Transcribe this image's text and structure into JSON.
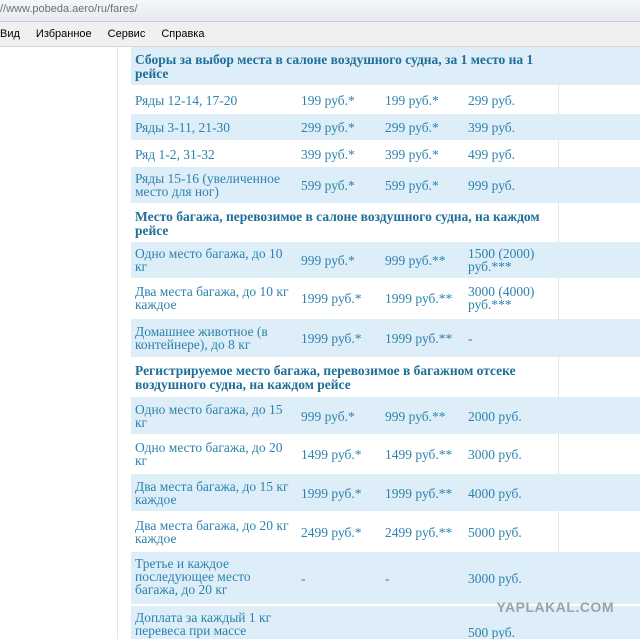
{
  "browser": {
    "url": "//www.pobeda.aero/ru/fares/"
  },
  "menu": [
    "Вид",
    "Избранное",
    "Сервис",
    "Справка"
  ],
  "sections": [
    {
      "title": "Сборы за выбор места в салоне воздушного судна, за 1 место на 1 рейсе",
      "rows": [
        [
          "Ряды 12-14, 17-20",
          "199 руб.*",
          "199 руб.*",
          "299 руб."
        ],
        [
          "Ряды 3-11, 21-30",
          "299 руб.*",
          "299 руб.*",
          "399 руб."
        ],
        [
          "Ряд 1-2, 31-32",
          "399 руб.*",
          "399 руб.*",
          "499 руб."
        ],
        [
          "Ряды 15-16 (увеличенное место для ног)",
          "599 руб.*",
          "599 руб.*",
          "999 руб."
        ]
      ]
    },
    {
      "title": "Место багажа, перевозимое в салоне воздушного судна, на каждом рейсе",
      "rows": [
        [
          "Одно место багажа, до 10 кг",
          "999 руб.*",
          "999 руб.**",
          "1500 (2000) руб.***"
        ],
        [
          "Два места багажа, до 10 кг каждое",
          "1999 руб.*",
          "1999 руб.**",
          "3000 (4000) руб.***"
        ],
        [
          "Домашнее животное (в контейнере), до 8 кг",
          "1999 руб.*",
          "1999 руб.**",
          "-"
        ]
      ]
    },
    {
      "title": "Регистрируемое место багажа, перевозимое в багажном отсеке воздушного судна, на каждом рейсе",
      "rows": [
        [
          "Одно место багажа, до 15 кг",
          "999 руб.*",
          "999 руб.**",
          "2000 руб."
        ],
        [
          "Одно место багажа, до 20 кг",
          "1499 руб.*",
          "1499 руб.**",
          "3000 руб."
        ],
        [
          "Два места багажа, до 15 кг каждое",
          "1999 руб.*",
          "1999 руб.**",
          "4000 руб."
        ],
        [
          "Два места багажа, до 20 кг каждое",
          "2499 руб.*",
          "2499 руб.**",
          "5000 руб."
        ],
        [
          "Третье и каждое последующее место багажа, до 20 кг",
          "-",
          "-",
          "3000 руб."
        ],
        [
          "Доплата за каждый 1 кг перевеса при массе",
          "",
          "",
          "500 руб."
        ]
      ]
    }
  ],
  "watermark": "YAPLAKAL.COM"
}
